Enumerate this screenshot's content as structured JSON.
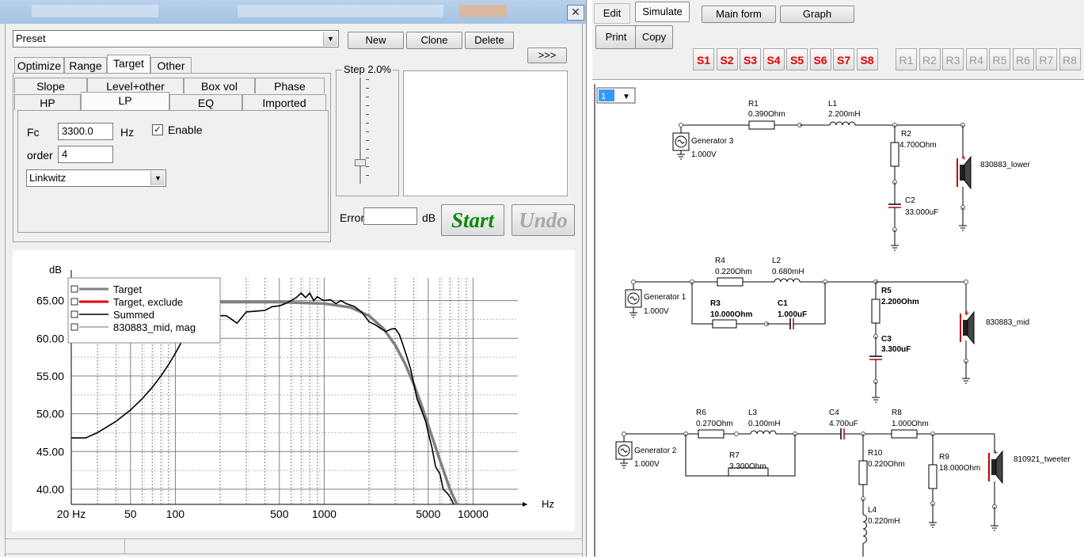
{
  "optimizer": {
    "title_icon": "close-icon",
    "close_label": "✕",
    "preset": {
      "value": "Preset",
      "new_label": "New",
      "clone_label": "Clone",
      "delete_label": "Delete",
      "more_label": ">>>"
    },
    "tabs_top": [
      "Optimize",
      "Range",
      "Target",
      "Other"
    ],
    "tabs_row2": [
      "Slope",
      "Level+other",
      "Box vol",
      "Phase"
    ],
    "tabs_row3": [
      "HP",
      "LP",
      "EQ",
      "Imported"
    ],
    "lp": {
      "fc_label": "Fc",
      "fc_value": "3300.0",
      "fc_unit": "Hz",
      "enable_label": "Enable",
      "enable_checked": true,
      "order_label": "order",
      "order_value": "4",
      "type_value": "Linkwitz"
    },
    "step_label": "Step 2.0%",
    "error_label": "Error",
    "error_value": "",
    "error_unit": "dB",
    "start_label": "Start",
    "undo_label": "Undo"
  },
  "chart_data": {
    "type": "line",
    "xscale": "log",
    "xlabel": "Hz",
    "ylabel": "dB",
    "xlim": [
      20,
      20000
    ],
    "ylim": [
      38,
      68
    ],
    "x_ticks": [
      "20 Hz",
      "50",
      "100",
      "500",
      "1000",
      "5000",
      "10000"
    ],
    "x_tick_values": [
      20,
      50,
      100,
      500,
      1000,
      5000,
      10000
    ],
    "y_ticks": [
      "65.00",
      "60.00",
      "55.00",
      "50.00",
      "45.00",
      "40.00"
    ],
    "y_tick_values": [
      65,
      60,
      55,
      50,
      45,
      40
    ],
    "series": [
      {
        "name": "Target",
        "color": "#808080",
        "x": [
          100,
          200,
          500,
          1000,
          1500,
          2000,
          2500,
          3000,
          3500,
          4000,
          4500,
          5000,
          6000,
          7000,
          8000
        ],
        "y": [
          64.8,
          64.8,
          64.8,
          64.6,
          64.1,
          63.0,
          61.3,
          59.1,
          56.6,
          53.9,
          51.2,
          48.5,
          43.8,
          40.0,
          37.5
        ]
      },
      {
        "name": "Target, exclude",
        "color": "#e00000",
        "x": [],
        "y": []
      },
      {
        "name": "Summed",
        "color": "#000000",
        "x": [
          20,
          25,
          30,
          40,
          50,
          60,
          70,
          80,
          90,
          100,
          110,
          120,
          130,
          150,
          180,
          220,
          260,
          300,
          350,
          400,
          450,
          500,
          550,
          600,
          650,
          700,
          750,
          800,
          850,
          900,
          950,
          1000,
          1100,
          1200,
          1300,
          1400,
          1500,
          1600,
          1700,
          1800,
          1900,
          2000,
          2200,
          2400,
          2600,
          2800,
          3000,
          3200,
          3400,
          3600,
          3800,
          4000,
          4200,
          4500,
          4800,
          5000,
          5300,
          5600,
          6000,
          6300,
          6700,
          7000,
          7500,
          8000
        ],
        "y": [
          46.8,
          46.8,
          47.5,
          49.0,
          50.5,
          52.0,
          53.5,
          55.0,
          56.5,
          58.0,
          59.5,
          60.5,
          61.5,
          62.5,
          63.0,
          63.0,
          62.0,
          63.5,
          63.6,
          63.7,
          64.2,
          64.3,
          64.6,
          65.0,
          65.4,
          66.0,
          65.4,
          66.0,
          65.0,
          65.5,
          65.2,
          65.0,
          65.1,
          64.6,
          65.0,
          64.6,
          64.4,
          64.2,
          63.8,
          63.4,
          62.8,
          62.2,
          61.8,
          61.3,
          60.9,
          61.2,
          61.3,
          60.5,
          59.0,
          57.5,
          56.0,
          54.0,
          52.0,
          50.5,
          49.0,
          47.5,
          45.5,
          43.0,
          42.0,
          40.0,
          39.5,
          39.0,
          37.8,
          37.0
        ]
      },
      {
        "name": "830883_mid, mag",
        "color": "#a0a0a0",
        "x": [],
        "y": []
      }
    ],
    "legend_position": "top-left",
    "grid": true
  },
  "simulator": {
    "menu": [
      "Edit",
      "Simulate",
      "Main form",
      "Graph",
      "Print",
      "Copy"
    ],
    "s_buttons": [
      "S1",
      "S2",
      "S3",
      "S4",
      "S5",
      "S6",
      "S7",
      "S8"
    ],
    "r_buttons": [
      "R1",
      "R2",
      "R3",
      "R4",
      "R5",
      "R6",
      "R7",
      "R8"
    ],
    "page_select": "1",
    "circuit1": {
      "generator": "Generator 3",
      "gen_voltage": "1.000V",
      "r1": "R1",
      "r1_val": "0.390Ohm",
      "l1": "L1",
      "l1_val": "2.200mH",
      "r2": "R2",
      "r2_val": "4.700Ohm",
      "c2": "C2",
      "c2_val": "33.000uF",
      "driver": "830883_lower"
    },
    "circuit2": {
      "generator": "Generator 1",
      "gen_voltage": "1.000V",
      "r4": "R4",
      "r4_val": "0.220Ohm",
      "l2": "L2",
      "l2_val": "0.680mH",
      "r3": "R3",
      "r3_val": "10.000Ohm",
      "c1": "C1",
      "c1_val": "1.000uF",
      "r5": "R5",
      "r5_val": "2.200Ohm",
      "c3": "C3",
      "c3_val": "3.300uF",
      "driver": "830883_mid"
    },
    "circuit3": {
      "generator": "Generator 2",
      "gen_voltage": "1.000V",
      "r6": "R6",
      "r6_val": "0.270Ohm",
      "l3": "L3",
      "l3_val": "0.100mH",
      "r7": "R7",
      "r7_val": "3.300Ohm",
      "c4": "C4",
      "c4_val": "4.700uF",
      "r8": "R8",
      "r8_val": "1.000Ohm",
      "r10": "R10",
      "r10_val": "0.220Ohm",
      "l4": "L4",
      "l4_val": "0.220mH",
      "r9": "R9",
      "r9_val": "18.000Ohm",
      "driver": "810921_tweeter"
    }
  }
}
